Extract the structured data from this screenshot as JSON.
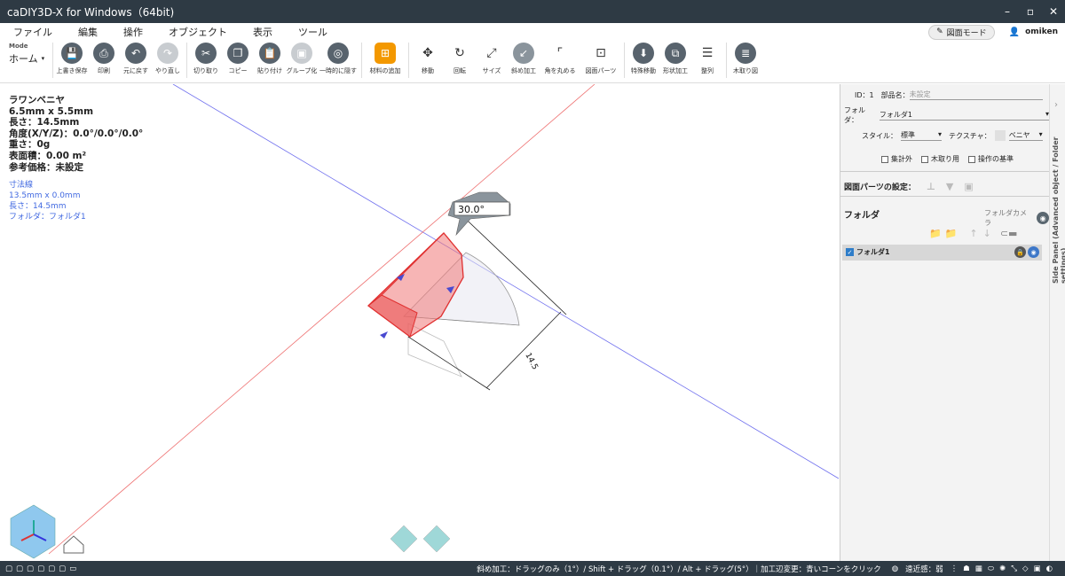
{
  "window": {
    "title": "caDIY3D-X for Windows（64bit)",
    "minimize": "–",
    "maximize": "▫",
    "close": "✕"
  },
  "menu": {
    "items": [
      "ファイル",
      "編集",
      "操作",
      "オブジェクト",
      "表示",
      "ツール"
    ],
    "mode_pill": "図面モード",
    "user": "omiken"
  },
  "toolbar": {
    "mode_label": "Mode",
    "mode_value": "ホーム",
    "tools": [
      {
        "label": "上書き保存",
        "icon": "save-icon"
      },
      {
        "label": "印刷",
        "icon": "print-icon"
      },
      {
        "label": "元に戻す",
        "icon": "undo-icon"
      },
      {
        "label": "やり直し",
        "icon": "redo-icon"
      },
      {
        "label": "切り取り",
        "icon": "cut-icon"
      },
      {
        "label": "コピー",
        "icon": "copy-icon"
      },
      {
        "label": "貼り付け",
        "icon": "paste-icon"
      },
      {
        "label": "グループ化",
        "icon": "group-icon"
      },
      {
        "label": "一時的に隠す",
        "icon": "hide-icon"
      },
      {
        "label": "材料の追加",
        "icon": "add-material-icon"
      },
      {
        "label": "移動",
        "icon": "move-icon"
      },
      {
        "label": "回転",
        "icon": "rotate-icon"
      },
      {
        "label": "サイズ",
        "icon": "resize-icon"
      },
      {
        "label": "斜め加工",
        "icon": "bevel-icon"
      },
      {
        "label": "角を丸める",
        "icon": "round-corner-icon"
      },
      {
        "label": "図面パーツ",
        "icon": "drawing-parts-icon"
      },
      {
        "label": "特殊移動",
        "icon": "special-move-icon"
      },
      {
        "label": "形状加工",
        "icon": "shape-process-icon"
      },
      {
        "label": "整列",
        "icon": "align-icon"
      },
      {
        "label": "木取り図",
        "icon": "cutting-list-icon"
      }
    ]
  },
  "info": {
    "material": "ラワンベニヤ",
    "size": "6.5mm x 5.5mm",
    "length": "長さ：14.5mm",
    "angle": "角度(X/Y/Z)：0.0°/0.0°/0.0°",
    "weight": "重さ：0g",
    "surface": "表面積：0.00 m²",
    "price": "参考価格：未設定"
  },
  "dimension": {
    "title": "寸法線",
    "size": "13.5mm x 0.0mm",
    "length": "長さ：14.5mm",
    "folder": "フォルダ：フォルダ1"
  },
  "viewport": {
    "angle_input": "30.0°",
    "dim_label": "14.5"
  },
  "sidebar": {
    "id_label": "ID：1",
    "part_name_label": "部品名：",
    "part_name_placeholder": "未設定",
    "folder_label": "フォルダ：",
    "folder_value": "フォルダ1",
    "style_label": "スタイル：",
    "style_value": "標準",
    "texture_label": "テクスチャ：",
    "texture_value": "ベニヤ",
    "check_exclude": "集計外",
    "check_lumber": "木取り用",
    "check_base": "操作の基準",
    "drawing_parts_label": "図面パーツの設定：",
    "folder_section": "フォルダ",
    "folder_camera": "フォルダカメラ",
    "folder_item": "フォルダ1",
    "vertical_tab": "Side Panel (Advanced object / Folder settings)"
  },
  "status": {
    "hint": "斜め加工：ドラッグのみ（1°）/ Shift + ドラッグ（0.1°）/ Alt + ドラッグ(5°）｜加工辺変更：青いコーンをクリック",
    "near": "遠近感：弱"
  },
  "colors": {
    "titlebar": "#2e3a44",
    "accent": "#f39800",
    "selection": "#e03030",
    "x_axis": "#e86060",
    "y_axis": "#6060e8"
  }
}
